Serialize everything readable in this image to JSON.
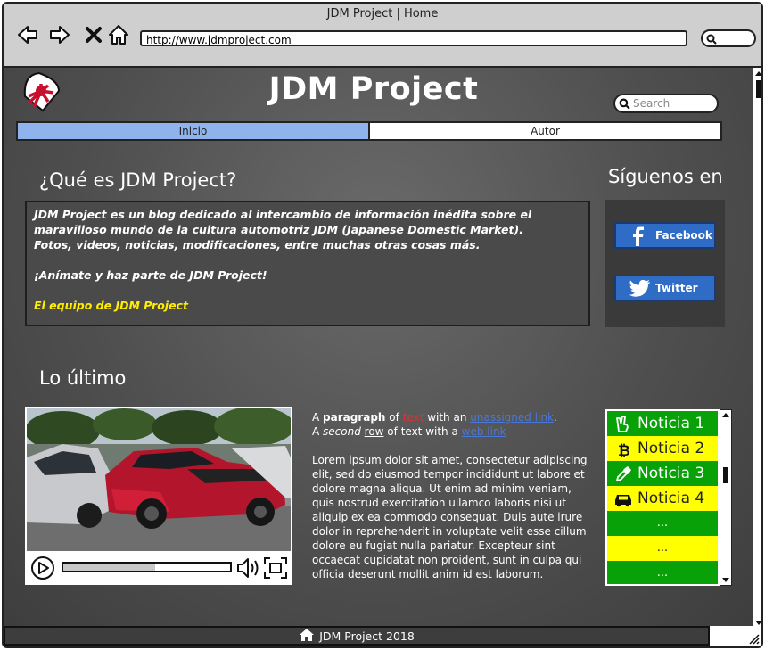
{
  "window": {
    "title": "JDM Project | Home",
    "url": "http://www.jdmproject.com"
  },
  "site": {
    "title": "JDM Project",
    "search_placeholder": "Search"
  },
  "nav": {
    "tabs": [
      "Inicio",
      "Autor"
    ]
  },
  "about": {
    "heading": "¿Qué es JDM Project?",
    "line1": "JDM Project es un blog dedicado al intercambio de información inédita sobre el maravilloso mundo de la cultura automotriz JDM (Japanese Domestic Market).",
    "line2": "Fotos, videos, noticias, modificaciones, entre muchas otras cosas más.",
    "line3": "¡Anímate y haz parte de JDM Project!",
    "signature": "El equipo de JDM Project"
  },
  "social": {
    "heading": "Síguenos en",
    "facebook": "Facebook",
    "twitter": "Twitter"
  },
  "latest": {
    "heading": "Lo último",
    "p1": {
      "a": "A ",
      "b": "paragraph",
      "c": " of ",
      "d": "text",
      "e": " with an ",
      "f": "unassigned link",
      "g": "."
    },
    "p2": {
      "a": "A ",
      "b": "second",
      "c": " ",
      "d": "row",
      "e": " of ",
      "f": "text",
      "g": " with a ",
      "h": "web link"
    },
    "lorem": "Lorem ipsum dolor sit amet, consectetur adipiscing elit, sed do eiusmod tempor incididunt ut labore et dolore magna aliqua. Ut enim ad minim veniam, quis nostrud exercitation ullamco laboris nisi ut aliquip ex ea commodo consequat. Duis aute irure dolor in reprehenderit in voluptate velit esse cillum dolore eu fugiat nulla pariatur. Excepteur sint occaecat cupidatat non proident, sunt in culpa qui officia deserunt mollit anim id est laborum.",
    "video_progress": 0.55
  },
  "news": {
    "items": [
      {
        "label": "Noticia 1",
        "icon": "peace-hand-icon",
        "color": "#08a108"
      },
      {
        "label": "Noticia 2",
        "icon": "bitcoin-icon",
        "color": "#ffff00"
      },
      {
        "label": "Noticia 3",
        "icon": "eyedropper-icon",
        "color": "#08a108"
      },
      {
        "label": "Noticia 4",
        "icon": "car-icon",
        "color": "#ffff00"
      },
      {
        "label": "...",
        "color": "#08a108"
      },
      {
        "label": "...",
        "color": "#ffff00"
      },
      {
        "label": "...",
        "color": "#08a108"
      }
    ]
  },
  "footer": {
    "text": "JDM Project 2018"
  }
}
